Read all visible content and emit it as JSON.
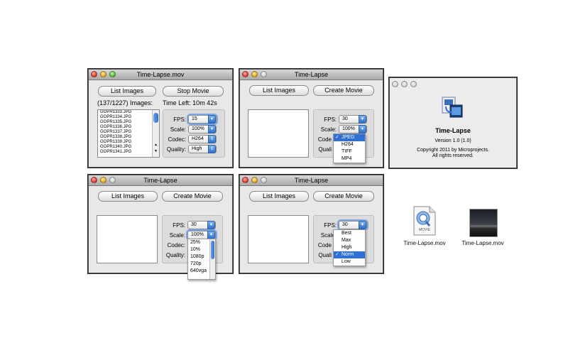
{
  "win1": {
    "title": "Time-Lapse.mov",
    "list_images": "List Images",
    "stop_movie": "Stop Movie",
    "images_count": "(137/1227) Images:",
    "time_left": "Time Left: 10m 42s",
    "files": [
      "GOPR1333.JPG",
      "GOPR1334.JPG",
      "GOPR1335.JPG",
      "GOPR1336.JPG",
      "GOPR1337.JPG",
      "GOPR1338.JPG",
      "GOPR1339.JPG",
      "GOPR1340.JPG",
      "GOPR1341.JPG"
    ],
    "fps_label": "FPS:",
    "fps_value": "15",
    "scale_label": "Scale:",
    "scale_value": "100%",
    "codec_label": "Codec:",
    "codec_value": "H264",
    "quality_label": "Quality:",
    "quality_value": "High"
  },
  "win2": {
    "title": "Time-Lapse",
    "list_images": "List Images",
    "create_movie": "Create Movie",
    "fps_label": "FPS:",
    "fps_value": "30",
    "scale_label": "Scale:",
    "scale_value": "100%",
    "codec_label": "Code",
    "quality_label": "Quali",
    "codec_options": [
      {
        "label": "JPEG",
        "checked": true,
        "highlight": true
      },
      {
        "label": "H264"
      },
      {
        "label": "TIFF"
      },
      {
        "label": "MP4"
      }
    ]
  },
  "about": {
    "app_name": "Time-Lapse",
    "version": "Version 1.0 (1.0)",
    "copyright": "Copyright 2011 by Microprojects.",
    "rights": "All rights reserved."
  },
  "win3": {
    "title": "Time-Lapse",
    "list_images": "List Images",
    "create_movie": "Create Movie",
    "fps_label": "FPS:",
    "fps_value": "30",
    "scale_label": "Scale:",
    "scale_value": "100%",
    "codec_label": "Codec:",
    "quality_label": "Quality:",
    "scale_options": [
      "25%",
      "10%",
      "1080p",
      "720p",
      "640vga"
    ]
  },
  "win4": {
    "title": "Time-Lapse",
    "list_images": "List Images",
    "create_movie": "Create Movie",
    "fps_label": "FPS:",
    "fps_value": "30",
    "scale_label": "Scale:",
    "codec_label": "Code",
    "quality_label": "Quali",
    "quality_options": [
      {
        "label": "Best"
      },
      {
        "label": "Max"
      },
      {
        "label": "High"
      },
      {
        "label": "Norm",
        "checked": true,
        "highlight": true
      },
      {
        "label": "Low"
      }
    ]
  },
  "desktop": {
    "movie_icon_label": "Time-Lapse.mov",
    "movie_badge": "MOVIE",
    "thumb_label": "Time-Lapse.mov"
  },
  "colors": {
    "highlight": "#2f6fd6",
    "window_bg": "#e8e8e8"
  }
}
